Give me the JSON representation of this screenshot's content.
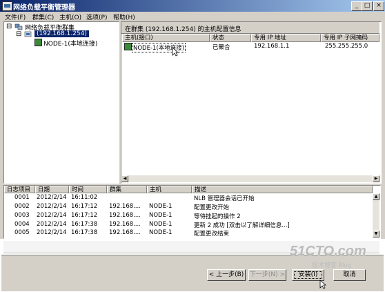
{
  "window": {
    "title": "网络负载平衡管理器",
    "min": "_",
    "max": "□",
    "close": "×"
  },
  "menu": [
    {
      "label": "文件(F)"
    },
    {
      "label": "群集(C)"
    },
    {
      "label": "主机(O)"
    },
    {
      "label": "选项(P)"
    },
    {
      "label": "帮助(H)"
    }
  ],
  "tree": {
    "root": "网络负载平衡群集",
    "cluster": "(192.168.1.254)",
    "node": "NODE-1(本地连接)",
    "expand_glyph": "⊟"
  },
  "details": {
    "header": "在群集 (192.168.1.254) 的主机配置信息",
    "columns": [
      "主机(接口)",
      "状态",
      "专用 IP 地址",
      "专用 IP 子网掩码"
    ],
    "rows": [
      [
        "NODE-1(本地连接)",
        "已聚合",
        "192.168.1.1",
        "255.255.255.0"
      ]
    ]
  },
  "log": {
    "columns": [
      "日志项目",
      "日期",
      "时间",
      "群集",
      "主机",
      "描述"
    ],
    "rows": [
      [
        "0001",
        "2012/2/14",
        "16:11:02",
        "",
        "",
        "NLB 管理器会话已开始"
      ],
      [
        "0002",
        "2012/2/14",
        "16:17:12",
        "192.168....",
        "NODE-1",
        "配置更改开始"
      ],
      [
        "0003",
        "2012/2/14",
        "16:17:12",
        "192.168....",
        "NODE-1",
        "等待挂起的操作 2"
      ],
      [
        "0004",
        "2012/2/14",
        "16:17:38",
        "192.168....",
        "NODE-1",
        "更新 2 成功 [双击以了解详细信息...]"
      ],
      [
        "0005",
        "2012/2/14",
        "16:17:38",
        "192.168....",
        "NODE-1",
        "配置更改结束"
      ]
    ]
  },
  "wizard": {
    "back": "< 上一步(B)",
    "next": "下一步(N) >",
    "install": "安装(I)",
    "cancel": "取消"
  },
  "watermark": {
    "main": "51CTO.com",
    "sub": "技术博客 Blog"
  }
}
